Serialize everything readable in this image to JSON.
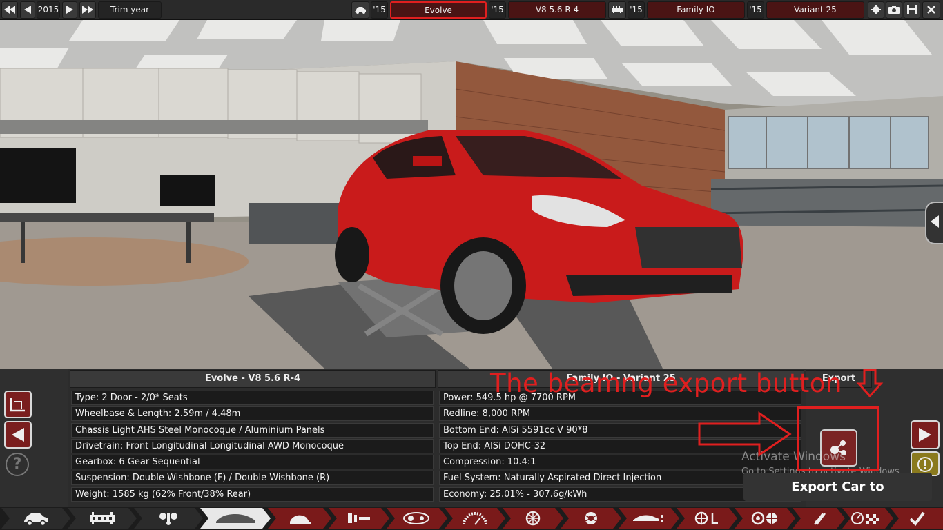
{
  "top_bar": {
    "year": "2015",
    "trim_year_label": "Trim year",
    "model_year_tag": "'15",
    "model_name": "Evolve",
    "engine_year_tag": "'15",
    "engine_name": "V8 5.6 R-4",
    "family_year_tag": "'15",
    "family_name": "Family IO",
    "variant_year_tag": "'15",
    "variant_name": "Variant 25"
  },
  "car_panel": {
    "title": "Evolve - V8 5.6 R-4",
    "rows": [
      "Type: 2 Door - 2/0* Seats",
      "Wheelbase & Length: 2.59m / 4.48m",
      "Chassis Light AHS Steel Monocoque / Aluminium Panels",
      "Drivetrain: Front Longitudinal Longitudinal AWD Monocoque",
      "Gearbox: 6 Gear Sequential",
      "Suspension: Double Wishbone (F) / Double Wishbone (R)",
      "Weight: 1585 kg (62% Front/38% Rear)"
    ]
  },
  "engine_panel": {
    "title": "Family IO - Variant 25",
    "rows": [
      "Power: 549.5 hp @ 7700 RPM",
      "Redline:  8,000 RPM",
      "Bottom End: AlSi 5591cc V 90*8",
      "Top End: AlSi DOHC-32",
      "Compression: 10.4:1",
      "Fuel System: Naturally Aspirated Direct Injection",
      "Economy: 25.01% - 307.6g/kWh"
    ]
  },
  "export_panel": {
    "title": "Export",
    "tooltip": "Export Car to BeamNG.drive"
  },
  "annotation": {
    "text": "The beamng export button"
  },
  "watermark": {
    "line1": "Activate Windows",
    "line2": "Go to Settings to activate Windows."
  },
  "help_label": "?",
  "colors": {
    "accent_red": "#e01f1f",
    "button_red": "#7a1e1e",
    "car_body": "#d21d1d"
  },
  "bottom_nav_icons": [
    "car-icon",
    "chassis-icon",
    "drivetrain-icon",
    "body-icon",
    "interior-icon",
    "fixture-icon",
    "lights-icon",
    "gauge-icon",
    "wheel-icon",
    "brake-icon",
    "aero-icon",
    "suspension-icon",
    "steering-icon",
    "tuning-icon",
    "test-track-icon",
    "confirm-icon"
  ]
}
